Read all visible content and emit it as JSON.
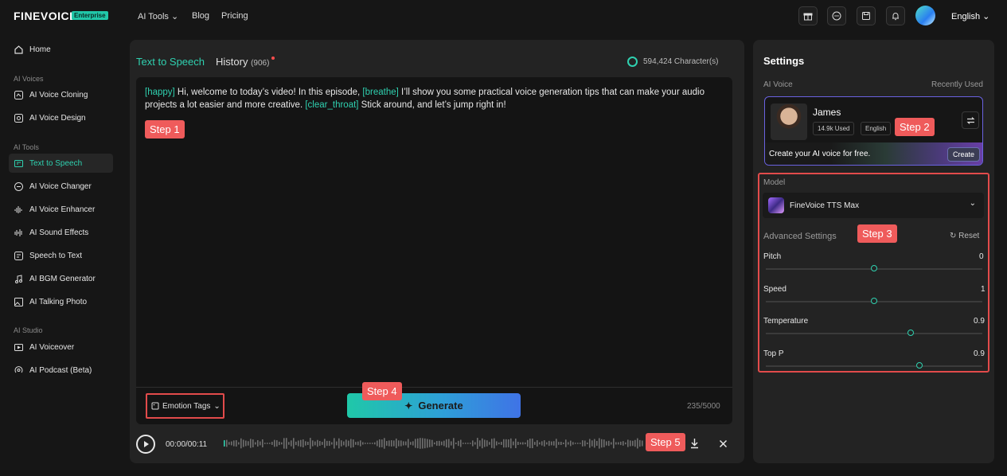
{
  "header": {
    "logo": "FINEVOICE",
    "badge": "Enterprise",
    "nav": [
      "AI Tools",
      "Blog",
      "Pricing"
    ],
    "icons": [
      "gift-icon",
      "chat-icon",
      "save-icon",
      "bell-icon"
    ],
    "language": "English"
  },
  "sidebar": {
    "home": "Home",
    "sections": {
      "ai_voices": "AI Voices",
      "ai_tools": "AI Tools",
      "ai_studio": "AI Studio"
    },
    "voices": [
      "AI Voice Cloning",
      "AI Voice Design"
    ],
    "tools": [
      "Text to Speech",
      "AI Voice Changer",
      "AI Voice Enhancer",
      "AI Sound Effects",
      "Speech to Text",
      "AI BGM Generator",
      "AI Talking Photo"
    ],
    "studio": [
      "AI Voiceover",
      "AI Podcast (Beta)"
    ]
  },
  "main": {
    "tab_tts": "Text to Speech",
    "tab_history": "History",
    "history_count": "(906)",
    "characters": "594,424 Character(s)",
    "text": {
      "t1": "[happy]",
      "t2": " Hi, welcome to today’s video! In this episode, ",
      "t3": "[breathe]",
      "t4": " I’ll show you some practical voice generation tips that can make your audio projects a lot easier and more creative. ",
      "t5": "[clear_throat]",
      "t6": " Stick around, and let’s jump right in!"
    },
    "emotion_tags": "Emotion Tags",
    "generate": "Generate",
    "counter": "235/5000",
    "time": "00:00/00:11"
  },
  "steps": [
    "Step 1",
    "Step 2",
    "Step 3",
    "Step 4",
    "Step 5"
  ],
  "settings": {
    "title": "Settings",
    "ai_voice": "AI Voice",
    "recently_used": "Recently Used",
    "voice": {
      "name": "James",
      "used": "14.9k Used",
      "language": "English"
    },
    "create_text": "Create your AI voice for free.",
    "create_btn": "Create",
    "model_label": "Model",
    "model": "FineVoice TTS Max",
    "advanced": "Advanced Settings",
    "reset": "Reset",
    "sliders": [
      {
        "label": "Pitch",
        "value": "0",
        "fraction": 0.5
      },
      {
        "label": "Speed",
        "value": "1",
        "fraction": 0.5
      },
      {
        "label": "Temperature",
        "value": "0.9",
        "fraction": 0.67
      },
      {
        "label": "Top P",
        "value": "0.9",
        "fraction": 0.71
      }
    ]
  },
  "colors": {
    "accent": "#2fd1b0",
    "step": "#ef5b5b",
    "highlight_border": "#e24b4b"
  }
}
